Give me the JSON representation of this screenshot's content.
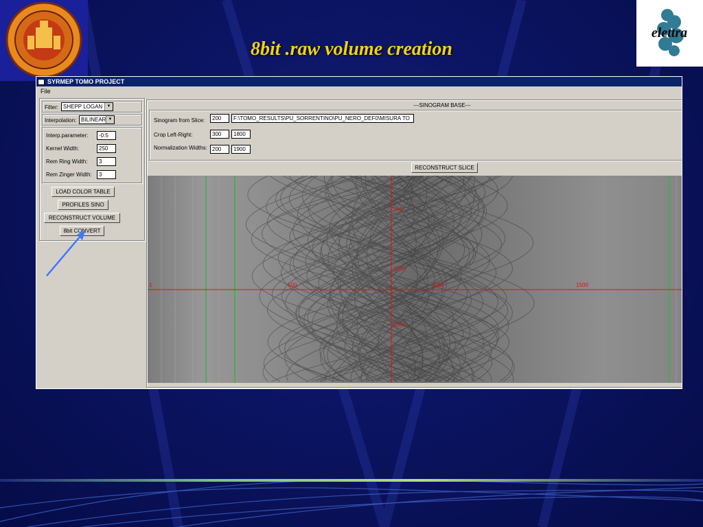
{
  "slide": {
    "title": "8bit .raw volume creation"
  },
  "logos": {
    "right_text": "elettra"
  },
  "window": {
    "title": "SYRMEP TOMO PROJECT",
    "menu": [
      "File"
    ],
    "left_panel": {
      "filter_label": "Filter:",
      "filter_value": "SHEPP LOGAN",
      "interp_label": "Interpolation:",
      "interp_value": "BILINEAR",
      "params": [
        {
          "label": "Interp.parameter:",
          "value": "-0.5"
        },
        {
          "label": "Kernel Width:",
          "value": "250"
        },
        {
          "label": "Rem Ring Width:",
          "value": "3"
        },
        {
          "label": "Rem Zinger Width:",
          "value": "3"
        }
      ],
      "buttons": {
        "load_color_table": "LOAD COLOR TABLE",
        "profiles_sino": "PROFILES SINO",
        "reconstruct_volume": "RECONSTRUCT VOLUME",
        "bit_convert": "8bit CONVERT"
      }
    },
    "sinogram_base": {
      "title": "---SINOGRAM BASE---",
      "slice_label": "Sinogram from Slice:",
      "slice_value": "200",
      "path_value": "F:\\TOMO_RESULTS\\PU_SORRENTINO\\PU_NERO_DEF0\\MISURA TO",
      "crop_label": "Crop Left-Right:",
      "crop_left": "300",
      "crop_right": "1800",
      "norm_label": "Normalization Widths:",
      "norm_left": "200",
      "norm_right": "1900",
      "reconstruct_slice": "RECONSTRUCT SLICE"
    },
    "sinogram_axes": {
      "x_ticks": [
        "1",
        "500",
        "1000",
        "1500"
      ],
      "y_ticks": [
        "500",
        "1000",
        "1500"
      ]
    }
  },
  "colors": {
    "title": "#f3d21a",
    "axis": "#e01010",
    "titlebar": "#0a246a"
  }
}
